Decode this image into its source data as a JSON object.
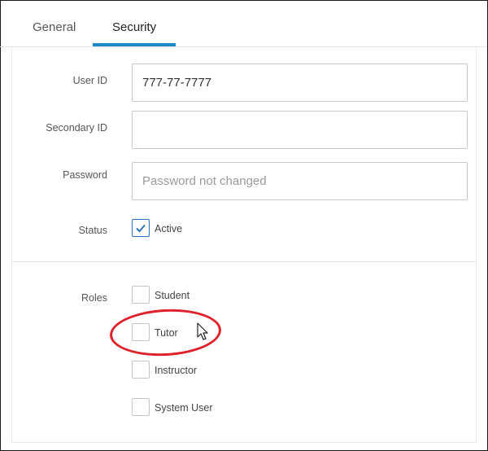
{
  "tabs": [
    {
      "label": "General",
      "active": false
    },
    {
      "label": "Security",
      "active": true
    }
  ],
  "form": {
    "user_id": {
      "label": "User ID",
      "value": "777-77-7777"
    },
    "secondary_id": {
      "label": "Secondary ID",
      "value": ""
    },
    "password": {
      "label": "Password",
      "placeholder": "Password not changed"
    },
    "status": {
      "label": "Status",
      "option": "Active",
      "checked": true
    },
    "roles": {
      "label": "Roles",
      "options": [
        {
          "label": "Student",
          "checked": false
        },
        {
          "label": "Tutor",
          "checked": false
        },
        {
          "label": "Instructor",
          "checked": false
        },
        {
          "label": "System User",
          "checked": false
        }
      ]
    }
  },
  "colors": {
    "accent": "#1e88c8",
    "checkbox_checked": "#2a73b8",
    "annotation": "#e0202a"
  }
}
